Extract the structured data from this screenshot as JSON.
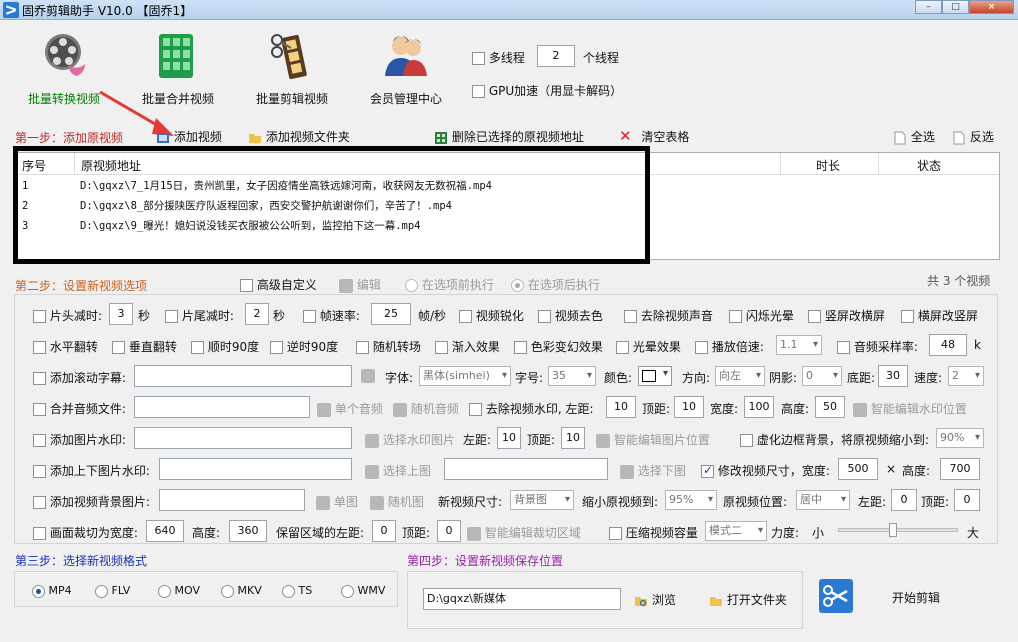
{
  "title": "固乔剪辑助手 V10.0 【固乔1】",
  "window_buttons": [
    "–",
    "□",
    "×"
  ],
  "toolbar": {
    "tools": [
      {
        "label": "批量转换视频",
        "color": "#008000"
      },
      {
        "label": "批量合并视频"
      },
      {
        "label": "批量剪辑视频"
      },
      {
        "label": "会员管理中心"
      }
    ],
    "multithread_label": "多线程",
    "thread_count": "2",
    "thread_unit": "个线程",
    "gpu_label": "GPU加速（用显卡解码）"
  },
  "step1": {
    "title": "第一步：添加原视频",
    "add_video": "添加视频",
    "add_folder": "添加视频文件夹",
    "delete_selected": "删除已选择的原视频地址",
    "clear_table": "清空表格",
    "select_all": "全选",
    "invert": "反选"
  },
  "table": {
    "columns": [
      "序号",
      "原视频地址",
      "时长",
      "状态"
    ],
    "rows": [
      {
        "idx": "1",
        "path": "D:\\gqxz\\7_1月15日，贵州凯里，女子因疫情坐高铁远嫁河南，收获网友无数祝福.mp4"
      },
      {
        "idx": "2",
        "path": "D:\\gqxz\\8_部分援陕医疗队返程回家，西安交警护航谢谢你们，辛苦了！.mp4"
      },
      {
        "idx": "3",
        "path": "D:\\gqxz\\9_曝光！媳妇说没钱买衣服被公公听到，监控拍下这一幕.mp4"
      }
    ]
  },
  "step2": {
    "title": "第二步：设置新视频选项",
    "advanced": "高级自定义",
    "edit": "编辑",
    "before": "在选项前执行",
    "after": "在选项后执行",
    "total": "共 3 个视频"
  },
  "row1": {
    "head_cut": "片头减时:",
    "head_val": "3",
    "sec1": "秒",
    "tail_cut": "片尾减时:",
    "tail_val": "2",
    "sec2": "秒",
    "fps": "帧速率:",
    "fps_val": "25",
    "fps_unit": "帧/秒",
    "sharpen": "视频锐化",
    "decolor": "视频去色",
    "mute": "去除视频声音",
    "flash": "闪烁光晕",
    "v2h": "竖屏改横屏",
    "h2v": "横屏改竖屏"
  },
  "row2": {
    "hflip": "水平翻转",
    "vflip": "垂直翻转",
    "cw90": "顺时90度",
    "ccw90": "逆时90度",
    "random_trans": "随机转场",
    "fade_in": "渐入效果",
    "color_fx": "色彩变幻效果",
    "halo": "光晕效果",
    "speed": "播放倍速:",
    "speed_val": "1.1",
    "samplerate": "音频采样率:",
    "samplerate_val": "48",
    "k": "k"
  },
  "row3": {
    "subtitle": "添加滚动字幕:",
    "font": "字体:",
    "font_val": "黑体(simhei)",
    "size": "字号:",
    "size_val": "35",
    "color": "颜色:",
    "direction": "方向:",
    "direction_val": "向左",
    "shadow": "阴影:",
    "shadow_val": "0",
    "bottom": "底距:",
    "bottom_val": "30",
    "speed": "速度:",
    "speed_val": "2"
  },
  "row4": {
    "merge_audio": "合并音频文件:",
    "single_audio": "单个音频",
    "random_audio": "随机音频",
    "remove_wm": "去除视频水印,",
    "left": "左距:",
    "left_val": "10",
    "top": "顶距:",
    "top_val": "10",
    "width": "宽度:",
    "width_val": "100",
    "height": "高度:",
    "height_val": "50",
    "smart_wm": "智能编辑水印位置"
  },
  "row5": {
    "img_wm": "添加图片水印:",
    "choose_wm": "选择水印图片",
    "left": "左距:",
    "left_val": "10",
    "top": "顶距:",
    "top_val": "10",
    "smart_img": "智能编辑图片位置",
    "blur_border": "虚化边框背景，将原视频缩小到:",
    "blur_val": "90%"
  },
  "row6": {
    "topbottom": "添加上下图片水印:",
    "choose_top": "选择上图",
    "choose_bottom": "选择下图",
    "resize": "修改视频尺寸，宽度:",
    "resize_w": "500",
    "x": "×",
    "height": "高度:",
    "resize_h": "700"
  },
  "row7": {
    "bg_img": "添加视频背景图片:",
    "single": "单图",
    "random": "随机图",
    "new_size": "新视频尺寸:",
    "new_size_val": "背景图",
    "shrink": "缩小原视频到:",
    "shrink_val": "95%",
    "pos": "原视频位置:",
    "pos_val": "居中",
    "left": "左距:",
    "left_val": "0",
    "top": "顶距:",
    "top_val": "0"
  },
  "row8": {
    "crop": "画面裁切为宽度:",
    "crop_w": "640",
    "height": "高度:",
    "crop_h": "360",
    "keep_left": "保留区域的左距:",
    "keep_left_val": "0",
    "top": "顶距:",
    "top_val": "0",
    "smart_crop": "智能编辑裁切区域",
    "compress": "压缩视频容量",
    "mode_val": "模式二",
    "strength": "力度:",
    "small": "小",
    "big": "大",
    "strength_level": 0.45
  },
  "step3": {
    "title": "第三步：选择新视频格式",
    "formats": [
      {
        "label": "MP4",
        "on": true
      },
      {
        "label": "FLV",
        "on": false
      },
      {
        "label": "MOV",
        "on": false
      },
      {
        "label": "MKV",
        "on": false
      },
      {
        "label": "TS",
        "on": false
      },
      {
        "label": "WMV",
        "on": false
      }
    ]
  },
  "step4": {
    "title": "第四步：设置新视频保存位置",
    "path": "D:\\gqxz\\新媒体",
    "browse": "浏览",
    "open_folder": "打开文件夹",
    "start": "开始剪辑"
  },
  "colors": {
    "step_red": "#c62828",
    "step_blue": "#1a2fbd",
    "step_purple": "#9b1fae",
    "accent": "#2a7ad2"
  }
}
